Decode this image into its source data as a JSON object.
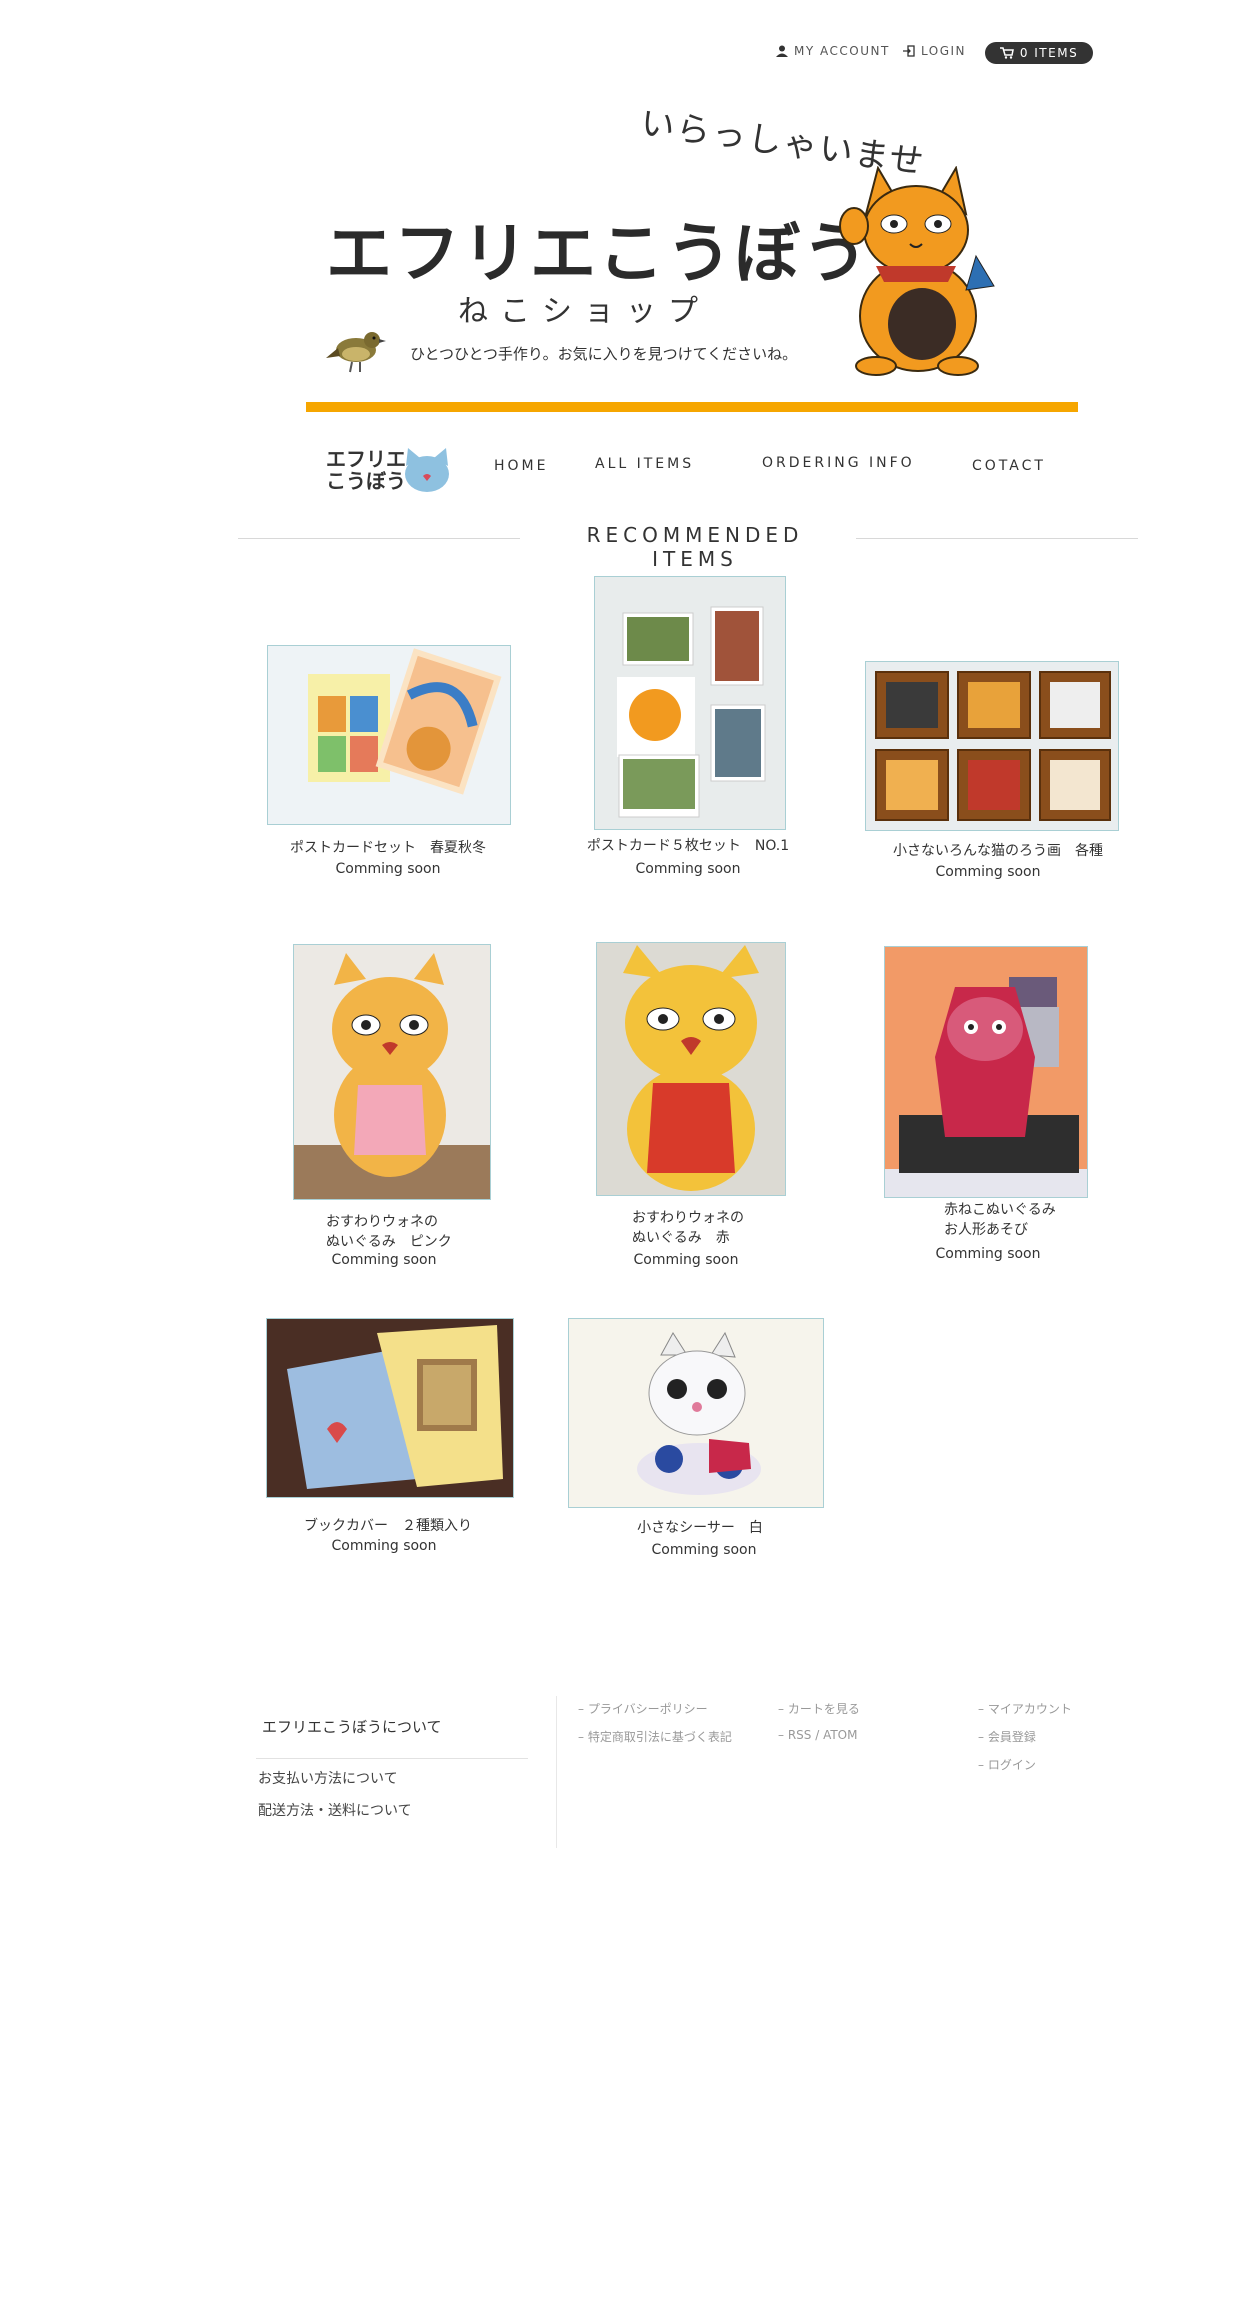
{
  "topbar": {
    "my_account": "MY ACCOUNT",
    "login": "LOGIN",
    "cart": "0 ITEMS"
  },
  "header": {
    "handwriting": "いらっしゃいませ",
    "title": "エフリエこうぼう",
    "subtitle": "ねこショップ",
    "tagline": "ひとつひとつ手作り。お気に入りを見つけてくださいね。",
    "accent_color": "#f6a600"
  },
  "nav": {
    "logo_line1": "エフリエ",
    "logo_line2": "こうぼう",
    "home": "HOME",
    "all_items": "ALL ITEMS",
    "ordering_info": "ORDERING INFO",
    "contact": "COTACT"
  },
  "section": {
    "title": "RECOMMENDED ITEMS"
  },
  "products": [
    {
      "name": "ポストカードセット　春夏秋冬",
      "status": "Comming soon"
    },
    {
      "name": "ポストカード５枚セット　NO.1",
      "status": "Comming soon"
    },
    {
      "name": "小さないろんな猫のろう画　各種",
      "status": "Comming soon"
    },
    {
      "name": "おすわりウォネの\nぬいぐるみ　ピンク",
      "status": "Comming soon"
    },
    {
      "name": "おすわりウォネの\nぬいぐるみ　赤",
      "status": "Comming soon"
    },
    {
      "name": "赤ねこぬいぐるみ\nお人形あそび",
      "status": "Comming soon"
    },
    {
      "name": "ブックカバー　２種類入り",
      "status": "Comming soon"
    },
    {
      "name": "小さなシーサー　白",
      "status": "Comming soon"
    }
  ],
  "footer": {
    "about_title": "エフリエこうぼうについて",
    "payment": "お支払い方法について",
    "shipping": "配送方法・送料について",
    "col1": [
      "プライバシーポリシー",
      "特定商取引法に基づく表記"
    ],
    "col2": [
      "カートを見る",
      "RSS / ATOM"
    ],
    "col3": [
      "マイアカウント",
      "会員登録",
      "ログイン"
    ]
  }
}
